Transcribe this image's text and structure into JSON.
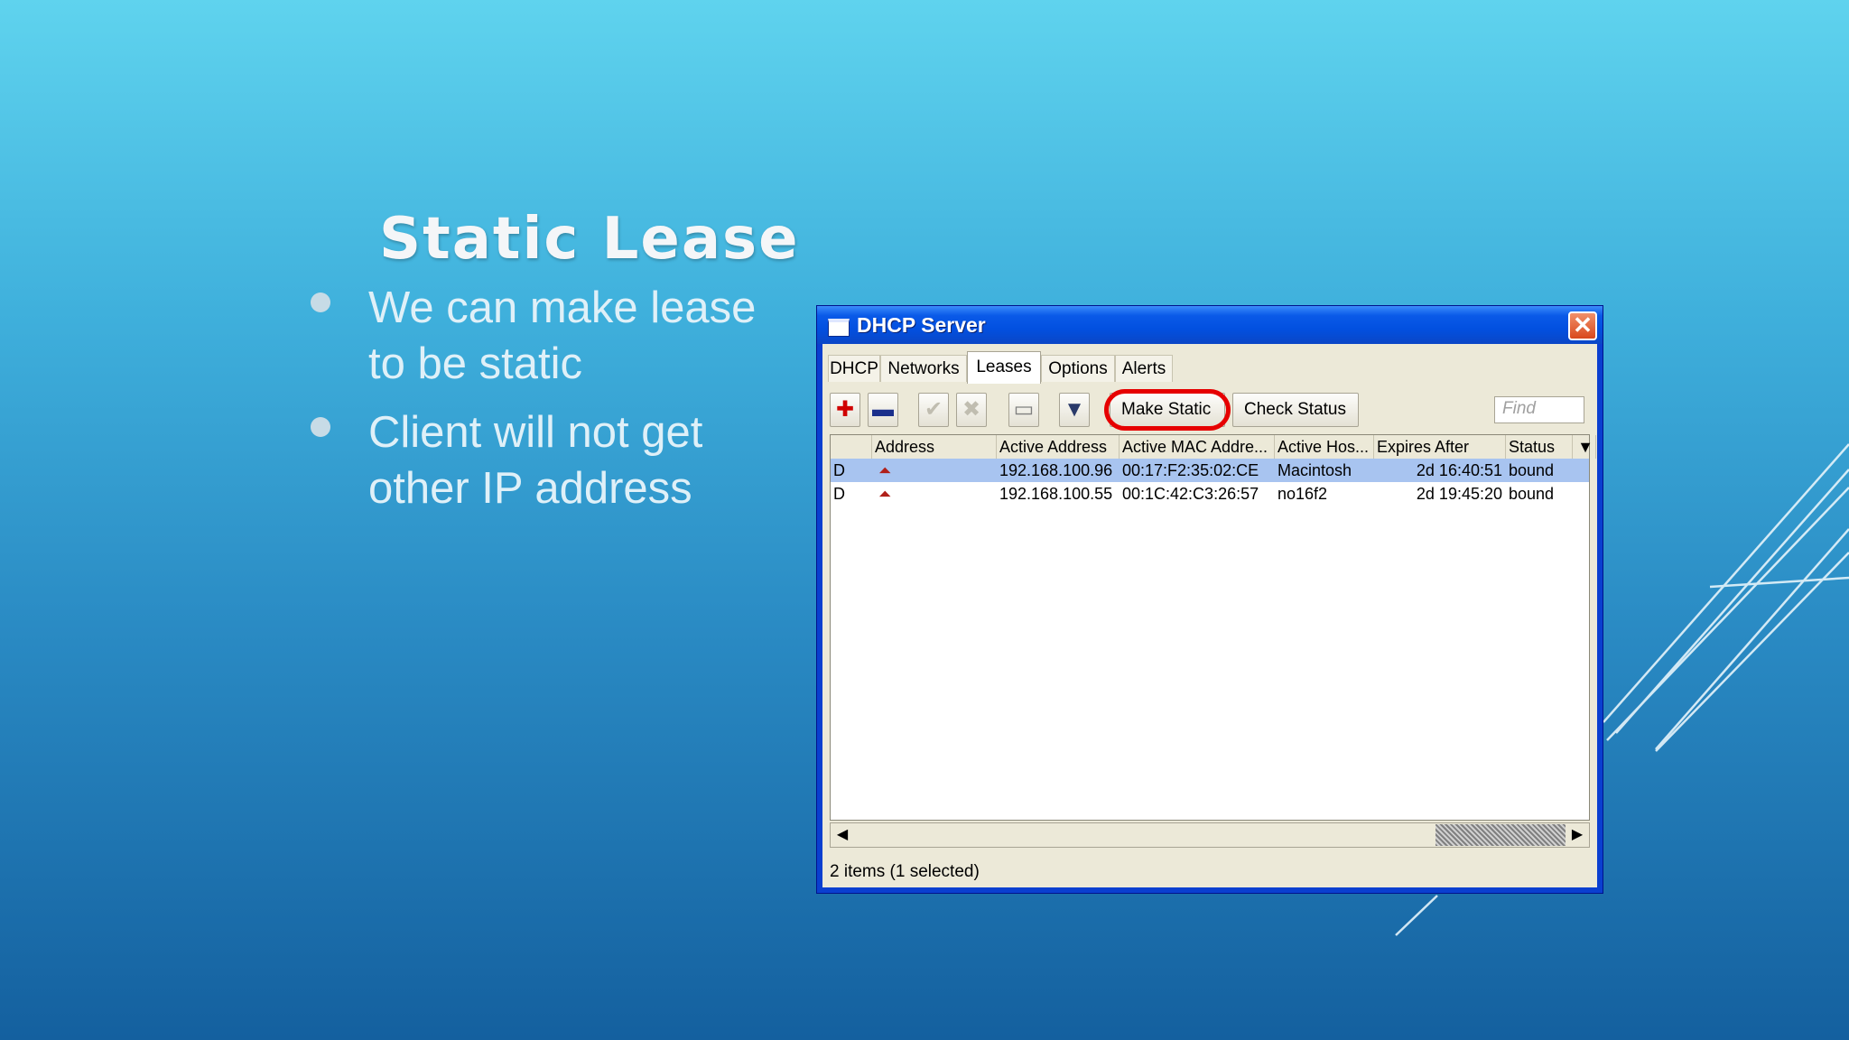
{
  "slide": {
    "title": "Static Lease",
    "bullets": [
      {
        "text": "We can make lease to be static"
      },
      {
        "text": "Client will not get other IP address"
      }
    ]
  },
  "window": {
    "title": "DHCP Server",
    "close_label": "✕",
    "tabs": [
      {
        "label": "DHCP"
      },
      {
        "label": "Networks"
      },
      {
        "label": "Leases",
        "active": true
      },
      {
        "label": "Options"
      },
      {
        "label": "Alerts"
      }
    ],
    "toolbar": {
      "add_label": "✚",
      "remove_label": "▬",
      "enable_label": "✔",
      "disable_label": "✖",
      "comment_label": "▭",
      "filter_label": "▼",
      "make_static_label": "Make Static",
      "check_status_label": "Check Status",
      "find_placeholder": "Find"
    },
    "table": {
      "columns": [
        "Address",
        "Active Address",
        "Active MAC Addre...",
        "Active Hos...",
        "Expires After",
        "Status"
      ],
      "rows": [
        {
          "flag": "D",
          "address": "",
          "active_address": "192.168.100.96",
          "mac": "00:17:F2:35:02:CE",
          "host": "Macintosh",
          "expires": "2d 16:40:51",
          "status": "bound",
          "selected": true
        },
        {
          "flag": "D",
          "address": "",
          "active_address": "192.168.100.55",
          "mac": "00:1C:42:C3:26:57",
          "host": "no16f2",
          "expires": "2d 19:45:20",
          "status": "bound",
          "selected": false
        }
      ]
    },
    "status_text": "2 items (1 selected)"
  }
}
